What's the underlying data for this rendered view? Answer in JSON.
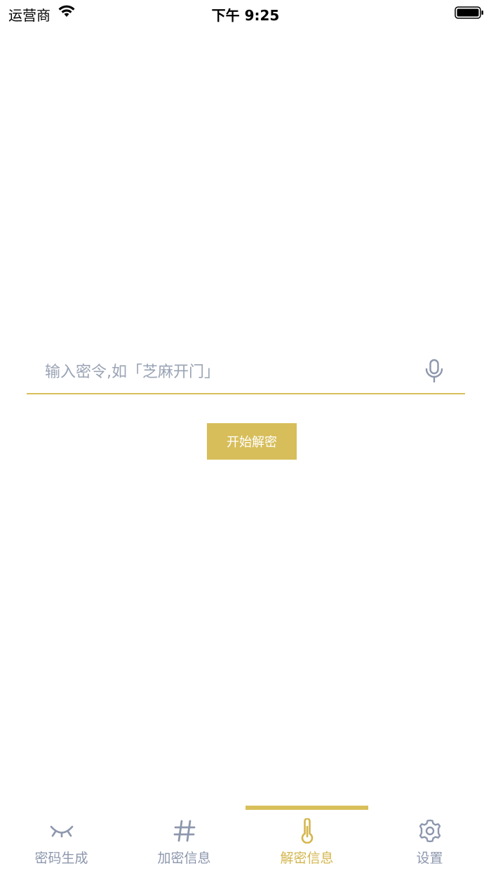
{
  "status_bar": {
    "carrier": "运营商",
    "time": "下午 9:25"
  },
  "decrypt": {
    "placeholder": "输入密令,如「芝麻开门」",
    "value": "",
    "start_button_label": "开始解密"
  },
  "tabs": [
    {
      "label": "密码生成",
      "icon": "closed-eye-icon",
      "active": false
    },
    {
      "label": "加密信息",
      "icon": "hash-icon",
      "active": false
    },
    {
      "label": "解密信息",
      "icon": "thermometer-icon",
      "active": true
    },
    {
      "label": "设置",
      "icon": "gear-icon",
      "active": false
    }
  ],
  "colors": {
    "accent": "#d8bf5a",
    "inactive": "#8d97ad",
    "placeholder": "#9aa3b5"
  }
}
